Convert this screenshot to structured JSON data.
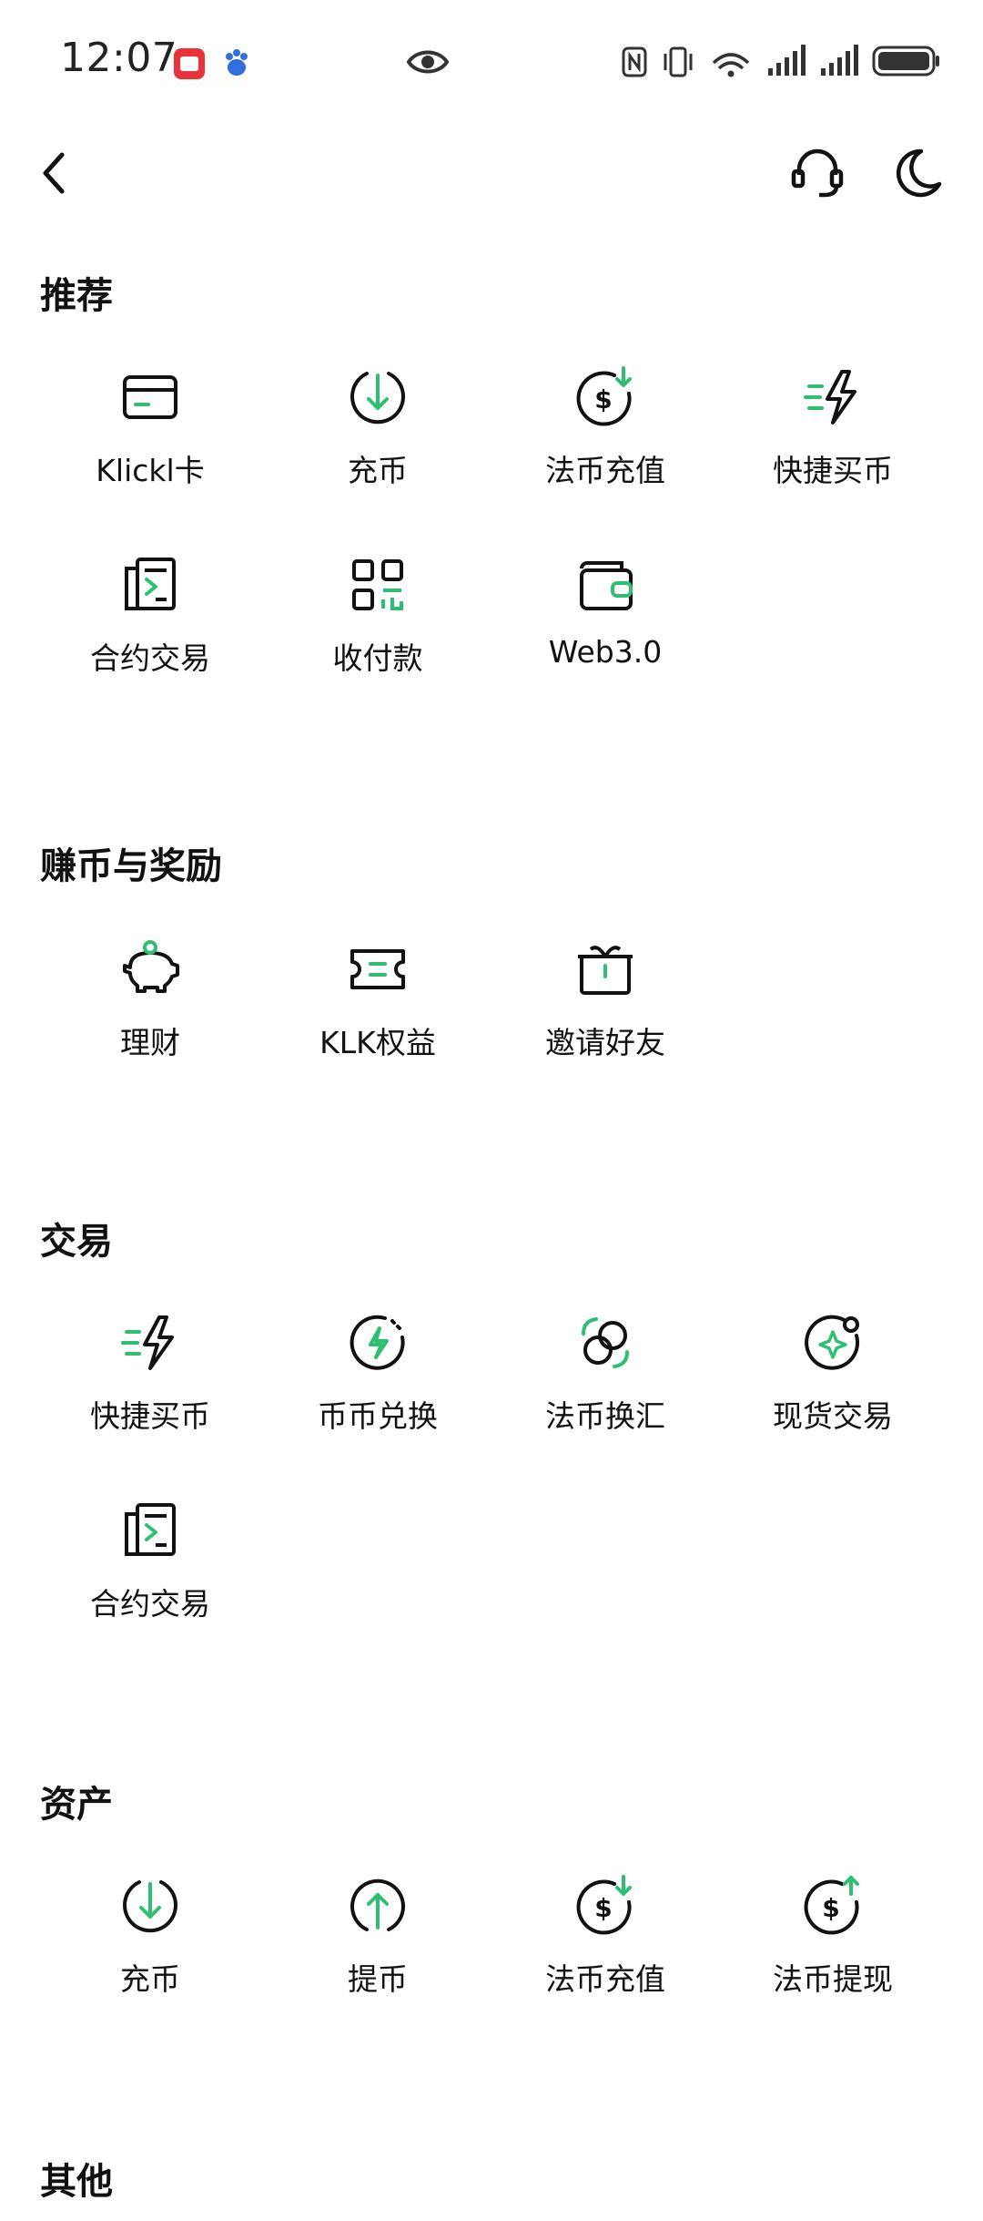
{
  "status_bar": {
    "time": "12:07"
  },
  "nav": {
    "back": "back",
    "support": "headset",
    "theme": "moon"
  },
  "sections": [
    {
      "title": "推荐",
      "items": [
        {
          "label": "Klickl卡",
          "icon": "card-icon"
        },
        {
          "label": "充币",
          "icon": "deposit-icon"
        },
        {
          "label": "法币充值",
          "icon": "fiat-deposit-icon"
        },
        {
          "label": "快捷买币",
          "icon": "quick-buy-icon"
        },
        {
          "label": "合约交易",
          "icon": "futures-icon"
        },
        {
          "label": "收付款",
          "icon": "qr-pay-icon"
        },
        {
          "label": "Web3.0",
          "icon": "wallet-icon"
        }
      ]
    },
    {
      "title": "赚币与奖励",
      "items": [
        {
          "label": "理财",
          "icon": "piggy-bank-icon"
        },
        {
          "label": "KLK权益",
          "icon": "ticket-icon"
        },
        {
          "label": "邀请好友",
          "icon": "gift-icon"
        }
      ]
    },
    {
      "title": "交易",
      "items": [
        {
          "label": "快捷买币",
          "icon": "quick-buy-icon"
        },
        {
          "label": "币币兑换",
          "icon": "convert-icon"
        },
        {
          "label": "法币换汇",
          "icon": "fx-icon"
        },
        {
          "label": "现货交易",
          "icon": "spot-icon"
        },
        {
          "label": "合约交易",
          "icon": "futures-icon"
        }
      ]
    },
    {
      "title": "资产",
      "items": [
        {
          "label": "充币",
          "icon": "deposit-icon"
        },
        {
          "label": "提币",
          "icon": "withdraw-icon"
        },
        {
          "label": "法币充值",
          "icon": "fiat-deposit-icon"
        },
        {
          "label": "法币提现",
          "icon": "fiat-withdraw-icon"
        }
      ]
    },
    {
      "title": "其他",
      "items": []
    }
  ],
  "colors": {
    "accent": "#2fbf71",
    "text": "#111111"
  }
}
